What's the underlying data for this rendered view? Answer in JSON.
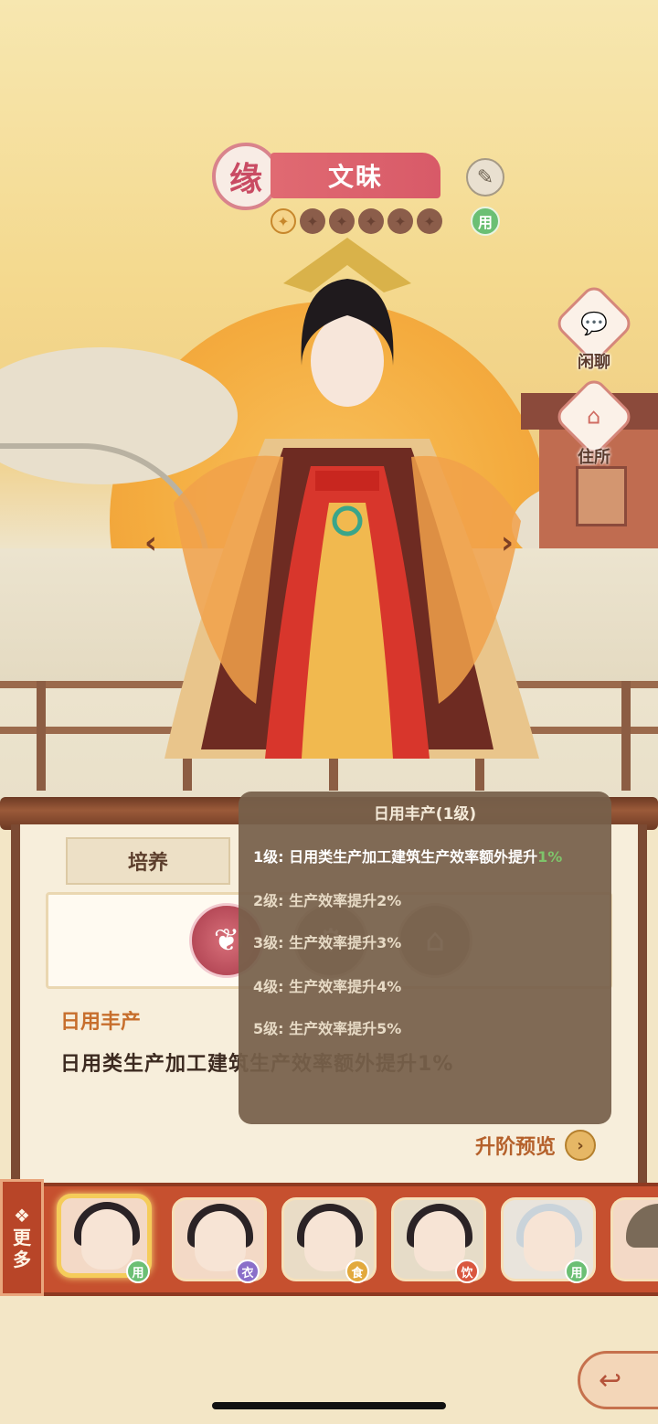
{
  "character": {
    "badge": "缘",
    "name": "文昧",
    "rename_icon": "brush-icon",
    "stars": {
      "filled": 1,
      "total": 6
    },
    "type_tag": "用"
  },
  "side_actions": {
    "chat_label": "闲聊",
    "chat_icon": "speech-bubble-icon",
    "residence_label": "住所",
    "residence_icon": "house-icon"
  },
  "nav": {
    "prev": "‹",
    "next": "›"
  },
  "tabs": {
    "cultivate": "培养"
  },
  "skill": {
    "name": "日用丰产",
    "description": "日用类生产加工建筑生产效率额外提升",
    "description_pct": "1%"
  },
  "upgrade_preview": {
    "label": "升阶预览",
    "icon": "chevron-right-icon"
  },
  "tooltip": {
    "title": "日用丰产(1级)",
    "levels": [
      {
        "label": "1级: 日用类生产加工建筑生产效率额外提升",
        "pct": "1%"
      },
      {
        "label": "2级: 生产效率提升2%",
        "pct": ""
      },
      {
        "label": "3级: 生产效率提升3%",
        "pct": ""
      },
      {
        "label": "4级: 生产效率提升4%",
        "pct": ""
      },
      {
        "label": "5级: 生产效率提升5%",
        "pct": ""
      }
    ]
  },
  "roster": {
    "more_label_1": "更",
    "more_label_2": "多",
    "items": [
      {
        "tag": "用",
        "tag_color": "#6bbf74",
        "selected": true
      },
      {
        "tag": "衣",
        "tag_color": "#8a6fc9",
        "selected": false
      },
      {
        "tag": "食",
        "tag_color": "#e2a93c",
        "selected": false
      },
      {
        "tag": "饮",
        "tag_color": "#d9573f",
        "selected": false
      },
      {
        "tag": "用",
        "tag_color": "#6bbf74",
        "selected": false
      }
    ]
  },
  "colors": {
    "accent_red": "#d85a68",
    "roster_bg": "#c6502f",
    "panel_wood": "#7b4a33",
    "skill_name": "#c76e2c"
  }
}
